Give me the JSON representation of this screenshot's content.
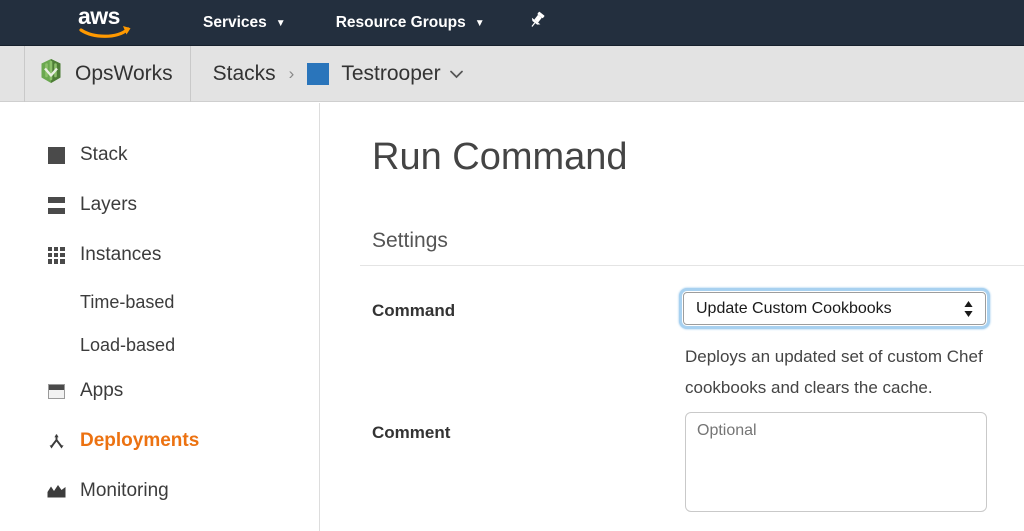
{
  "topnav": {
    "logo_text": "aws",
    "logo_alt": "aws-logo",
    "services_label": "Services",
    "resource_groups_label": "Resource Groups",
    "caret": "▼",
    "pin_icon": "pushpin-icon",
    "background": "#232f3e",
    "accent": "#ff9900"
  },
  "breadcrumb": {
    "service_label": "OpsWorks",
    "service_icon": "opsworks-leaf-icon",
    "stacks_label": "Stacks",
    "separator": "›",
    "stack_label": "Testrooper",
    "stack_color": "#2a75bb",
    "stack_caret": "⌄",
    "background": "#e3e3e3"
  },
  "sidebar": {
    "items": [
      {
        "label": "Stack",
        "icon": "stack-icon",
        "sub": false,
        "active": false
      },
      {
        "label": "Layers",
        "icon": "layers-icon",
        "sub": false,
        "active": false
      },
      {
        "label": "Instances",
        "icon": "instances-grid-icon",
        "sub": false,
        "active": false
      },
      {
        "label": "Time-based",
        "icon": "",
        "sub": true,
        "active": false
      },
      {
        "label": "Load-based",
        "icon": "",
        "sub": true,
        "active": false
      },
      {
        "label": "Apps",
        "icon": "apps-window-icon",
        "sub": false,
        "active": false
      },
      {
        "label": "Deployments",
        "icon": "deployments-branch-icon",
        "sub": false,
        "active": true
      },
      {
        "label": "Monitoring",
        "icon": "monitoring-chart-icon",
        "sub": false,
        "active": false
      }
    ],
    "active_color": "#ec7211"
  },
  "main": {
    "page_title": "Run Command",
    "section_title": "Settings",
    "command": {
      "label": "Command",
      "selected_value": "Update Custom Cookbooks",
      "description": "Deploys an updated set of custom Chef cookbooks and clears the cache.",
      "focused": true,
      "focus_ring_color": "#a8d1f0"
    },
    "comment": {
      "label": "Comment",
      "value": "",
      "placeholder": "Optional"
    }
  }
}
